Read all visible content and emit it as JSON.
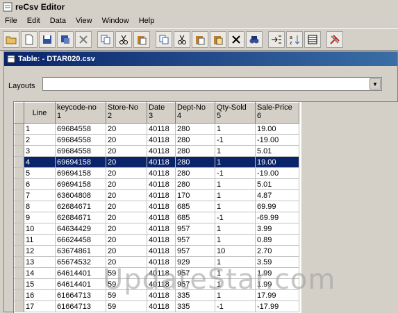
{
  "window": {
    "title": "reCsv Editor"
  },
  "menu": [
    "File",
    "Edit",
    "Data",
    "View",
    "Window",
    "Help"
  ],
  "toolbar": {
    "buttons": [
      "open-icon",
      "new-icon",
      "save-icon",
      "save-as-icon",
      "close-doc-icon",
      "copy-icon",
      "cut-icon",
      "paste-icon",
      "copy-row-icon",
      "cut-row-icon",
      "paste-row-icon",
      "paste-new-row-icon",
      "delete-icon",
      "find-icon",
      "insert-icon",
      "sort-icon",
      "table-icon",
      "tools-icon"
    ]
  },
  "frame": {
    "title": "Table:  - DTAR020.csv"
  },
  "layouts": {
    "label": "Layouts",
    "value": ""
  },
  "table": {
    "columns": [
      {
        "name": "Line",
        "num": ""
      },
      {
        "name": "keycode-no",
        "num": "1"
      },
      {
        "name": "Store-No",
        "num": "2"
      },
      {
        "name": "Date",
        "num": "3"
      },
      {
        "name": "Dept-No",
        "num": "4"
      },
      {
        "name": "Qty-Sold",
        "num": "5"
      },
      {
        "name": "Sale-Price",
        "num": "6"
      }
    ],
    "rows": [
      [
        "1",
        "69684558",
        "20",
        "40118",
        "280",
        "1",
        "19.00"
      ],
      [
        "2",
        "69684558",
        "20",
        "40118",
        "280",
        "-1",
        "-19.00"
      ],
      [
        "3",
        "69684558",
        "20",
        "40118",
        "280",
        "1",
        "5.01"
      ],
      [
        "4",
        "69694158",
        "20",
        "40118",
        "280",
        "1",
        "19.00"
      ],
      [
        "5",
        "69694158",
        "20",
        "40118",
        "280",
        "-1",
        "-19.00"
      ],
      [
        "6",
        "69694158",
        "20",
        "40118",
        "280",
        "1",
        "5.01"
      ],
      [
        "7",
        "63604808",
        "20",
        "40118",
        "170",
        "1",
        "4.87"
      ],
      [
        "8",
        "62684671",
        "20",
        "40118",
        "685",
        "1",
        "69.99"
      ],
      [
        "9",
        "62684671",
        "20",
        "40118",
        "685",
        "-1",
        "-69.99"
      ],
      [
        "10",
        "64634429",
        "20",
        "40118",
        "957",
        "1",
        "3.99"
      ],
      [
        "11",
        "66624458",
        "20",
        "40118",
        "957",
        "1",
        "0.89"
      ],
      [
        "12",
        "63674861",
        "20",
        "40118",
        "957",
        "10",
        "2.70"
      ],
      [
        "13",
        "65674532",
        "20",
        "40118",
        "929",
        "1",
        "3.59"
      ],
      [
        "14",
        "64614401",
        "59",
        "40118",
        "957",
        "1",
        "1.99"
      ],
      [
        "15",
        "64614401",
        "59",
        "40118",
        "957",
        "1",
        "1.99"
      ],
      [
        "16",
        "61664713",
        "59",
        "40118",
        "335",
        "1",
        "17.99"
      ],
      [
        "17",
        "61664713",
        "59",
        "40118",
        "335",
        "-1",
        "-17.99"
      ]
    ],
    "selected_row": 3
  },
  "watermark": "UpdateStar.com",
  "colors": {
    "selection": "#0a246a",
    "background": "#d4d0c8"
  }
}
